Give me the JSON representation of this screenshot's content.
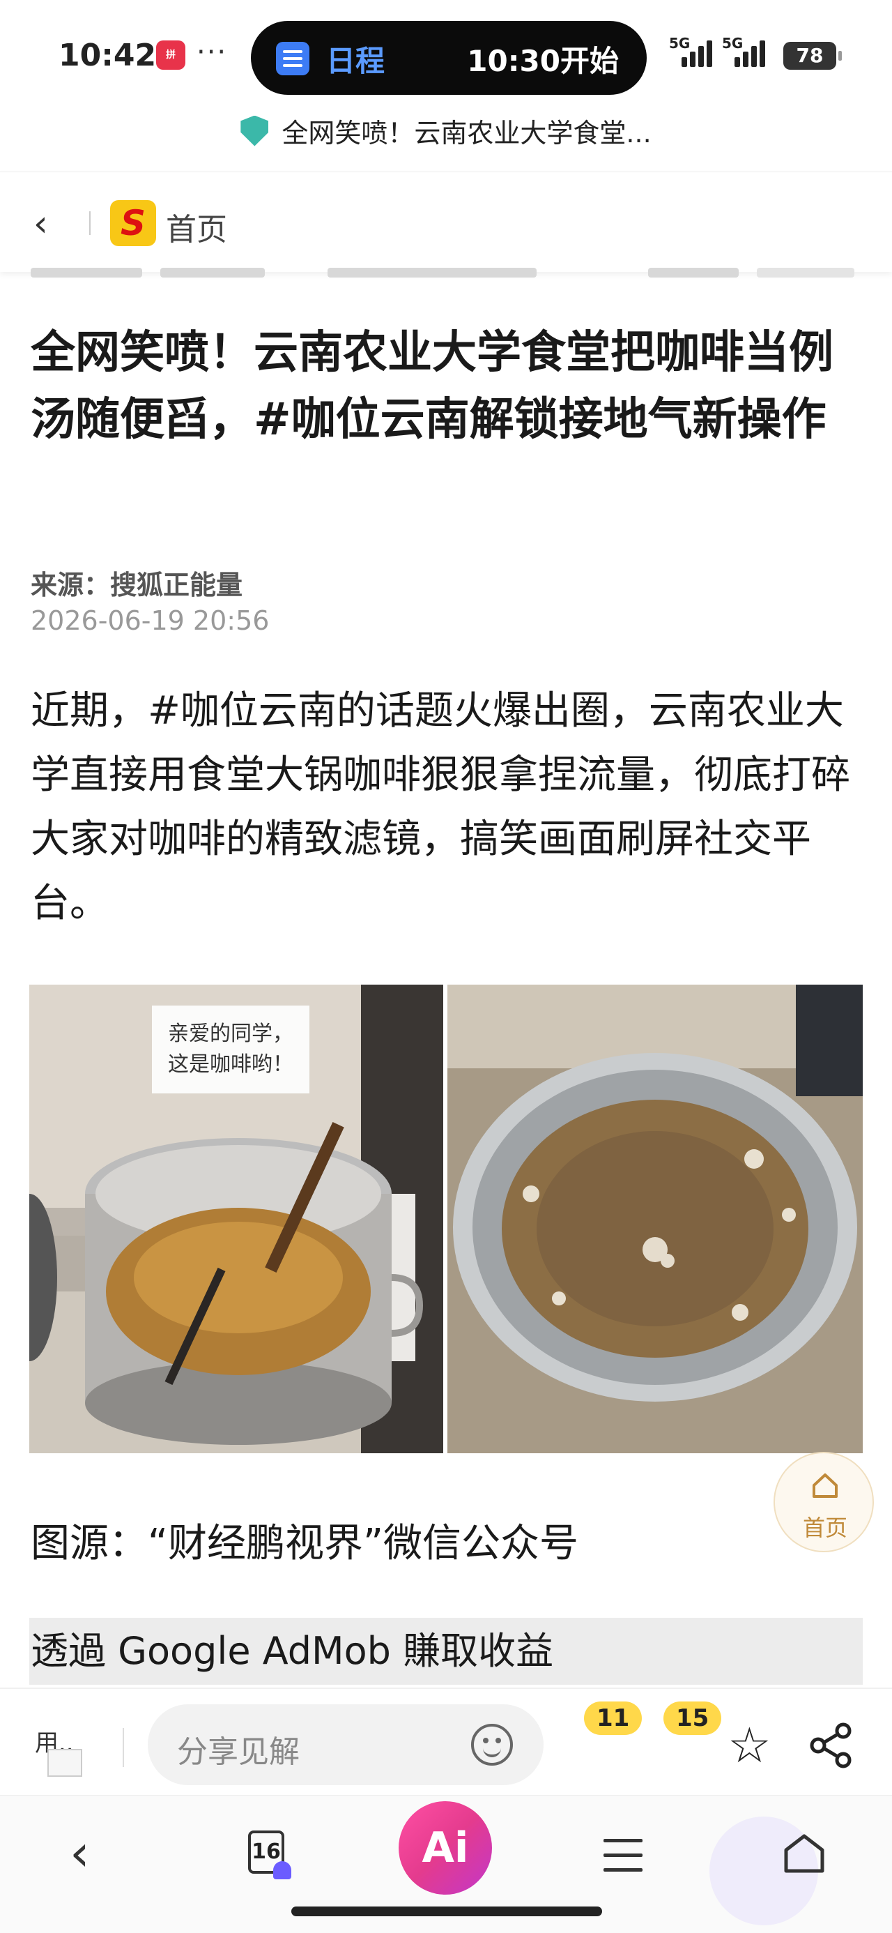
{
  "status_bar": {
    "time": "10:42",
    "app_badge": "拼",
    "more": "···",
    "island_label": "日程",
    "island_time": "10:30开始",
    "signal_1": "5G",
    "signal_2": "5G",
    "battery": "78"
  },
  "url_bar": {
    "title": "全网笑喷！云南农业大学食堂..."
  },
  "nav": {
    "back_icon": "chevron-left-icon",
    "logo": "S",
    "home_label": "首页"
  },
  "article": {
    "title": "全网笑喷！云南农业大学食堂把咖啡当例汤随便舀，#咖位云南解锁接地气新操作",
    "source": "来源：搜狐正能量",
    "date": "2026-06-19 20:56",
    "body": "近期，#咖位云南的话题火爆出圈，云南农业大学直接用食堂大锅咖啡狠狠拿捏流量，彻底打碎大家对咖啡的精致滤镜，搞笑画面刷屏社交平台。",
    "image_sign_line1": "亲爱的同学，",
    "image_sign_line2": "这是咖啡哟！",
    "caption": "图源：“财经鹏视界”微信公众号",
    "ad_text": "透過 Google AdMob 賺取收益"
  },
  "float_home": {
    "label": "首页"
  },
  "comment_bar": {
    "avatar_text": "用..",
    "input_placeholder": "分享见解",
    "comment_count": "11",
    "like_count": "15"
  },
  "bottom_bar": {
    "tab_count": "16",
    "ai_label": "Ai"
  },
  "colors": {
    "accent_yellow": "#ffd84a",
    "ai_gradient_start": "#ff4fa3",
    "ai_gradient_end": "#c237c9",
    "island_blue": "#5b9bff"
  }
}
